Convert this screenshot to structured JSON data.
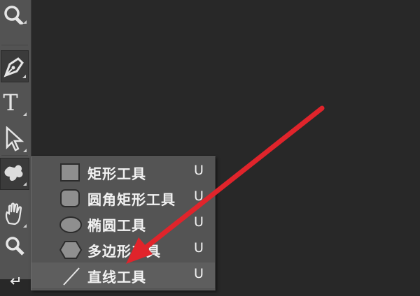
{
  "toolbar": {
    "tools": [
      {
        "name": "zoom-tool",
        "icon": "magnifier-icon"
      },
      {
        "name": "pen-tool",
        "icon": "pen-icon",
        "active": true
      },
      {
        "name": "type-tool",
        "icon": "type-icon",
        "glyph": "T"
      },
      {
        "name": "path-selection-tool",
        "icon": "arrow-cursor-icon"
      },
      {
        "name": "custom-shape-tool",
        "icon": "custom-shape-icon",
        "active": true
      },
      {
        "name": "hand-tool",
        "icon": "hand-icon"
      },
      {
        "name": "zoom-tool-bottom",
        "icon": "magnifier-icon"
      },
      {
        "name": "rotate-tool",
        "icon": "rotate-icon"
      }
    ]
  },
  "shape_menu": {
    "items": [
      {
        "label": "矩形工具",
        "shortcut": "U",
        "icon": "rectangle-icon"
      },
      {
        "label": "圆角矩形工具",
        "shortcut": "U",
        "icon": "rounded-rectangle-icon"
      },
      {
        "label": "椭圆工具",
        "shortcut": "U",
        "icon": "ellipse-icon"
      },
      {
        "label": "多边形工具",
        "shortcut": "U",
        "icon": "polygon-icon"
      },
      {
        "label": "直线工具",
        "shortcut": "U",
        "icon": "line-icon"
      }
    ]
  },
  "colors": {
    "canvas": "#282828",
    "toolbar": "#535353",
    "menu": "#545454",
    "annotation_arrow": "#e0242b"
  }
}
